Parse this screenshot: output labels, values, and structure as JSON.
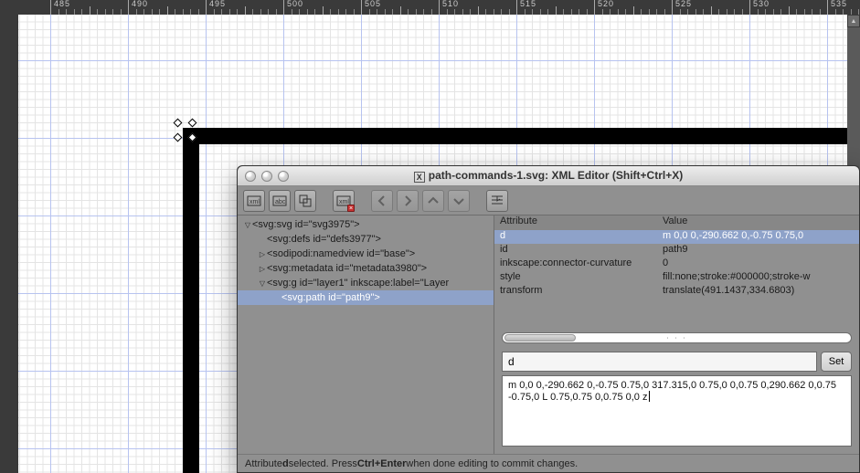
{
  "ruler": {
    "major_ticks": [
      485,
      490,
      495,
      500,
      505,
      510,
      515,
      520,
      525,
      530,
      535
    ]
  },
  "dialog": {
    "title_prefix": "path-commands-1.svg: XML Editor (Shift+Ctrl+X)",
    "toolbar": {
      "new_element": "New element node",
      "new_text": "New text node",
      "duplicate": "Duplicate node",
      "delete": "Delete node",
      "prev": "Previous",
      "next": "Next",
      "up": "Move up",
      "down": "Move down",
      "indent": "Indent"
    },
    "tree": [
      {
        "depth": 1,
        "exp": "open",
        "text": "<svg:svg id=\"svg3975\">"
      },
      {
        "depth": 2,
        "exp": "none",
        "text": "<svg:defs id=\"defs3977\">"
      },
      {
        "depth": 2,
        "exp": "closed",
        "text": "<sodipodi:namedview id=\"base\">"
      },
      {
        "depth": 2,
        "exp": "closed",
        "text": "<svg:metadata id=\"metadata3980\">"
      },
      {
        "depth": 2,
        "exp": "open",
        "text": "<svg:g id=\"layer1\" inkscape:label=\"Layer"
      },
      {
        "depth": 3,
        "exp": "none",
        "text": "<svg:path id=\"path9\">",
        "selected": true
      }
    ],
    "attr_head": {
      "c1": "Attribute",
      "c2": "Value"
    },
    "attrs": [
      {
        "name": "d",
        "value": "m 0,0 0,-290.662 0,-0.75 0.75,0",
        "selected": true
      },
      {
        "name": "id",
        "value": "path9"
      },
      {
        "name": "inkscape:connector-curvature",
        "value": "0"
      },
      {
        "name": "style",
        "value": "fill:none;stroke:#000000;stroke-w"
      },
      {
        "name": "transform",
        "value": "translate(491.1437,334.6803)"
      }
    ],
    "edit": {
      "name": "d",
      "set_label": "Set",
      "value": "m 0,0 0,-290.662 0,-0.75 0.75,0 317.315,0 0.75,0 0,0.75 0,290.662 0,0.75 -0.75,0 L 0.75,0.75 0,0.75 0,0 z"
    },
    "status_html": "Attribute <b>d</b> selected. Press <b>Ctrl+Enter</b> when done editing to commit changes."
  }
}
